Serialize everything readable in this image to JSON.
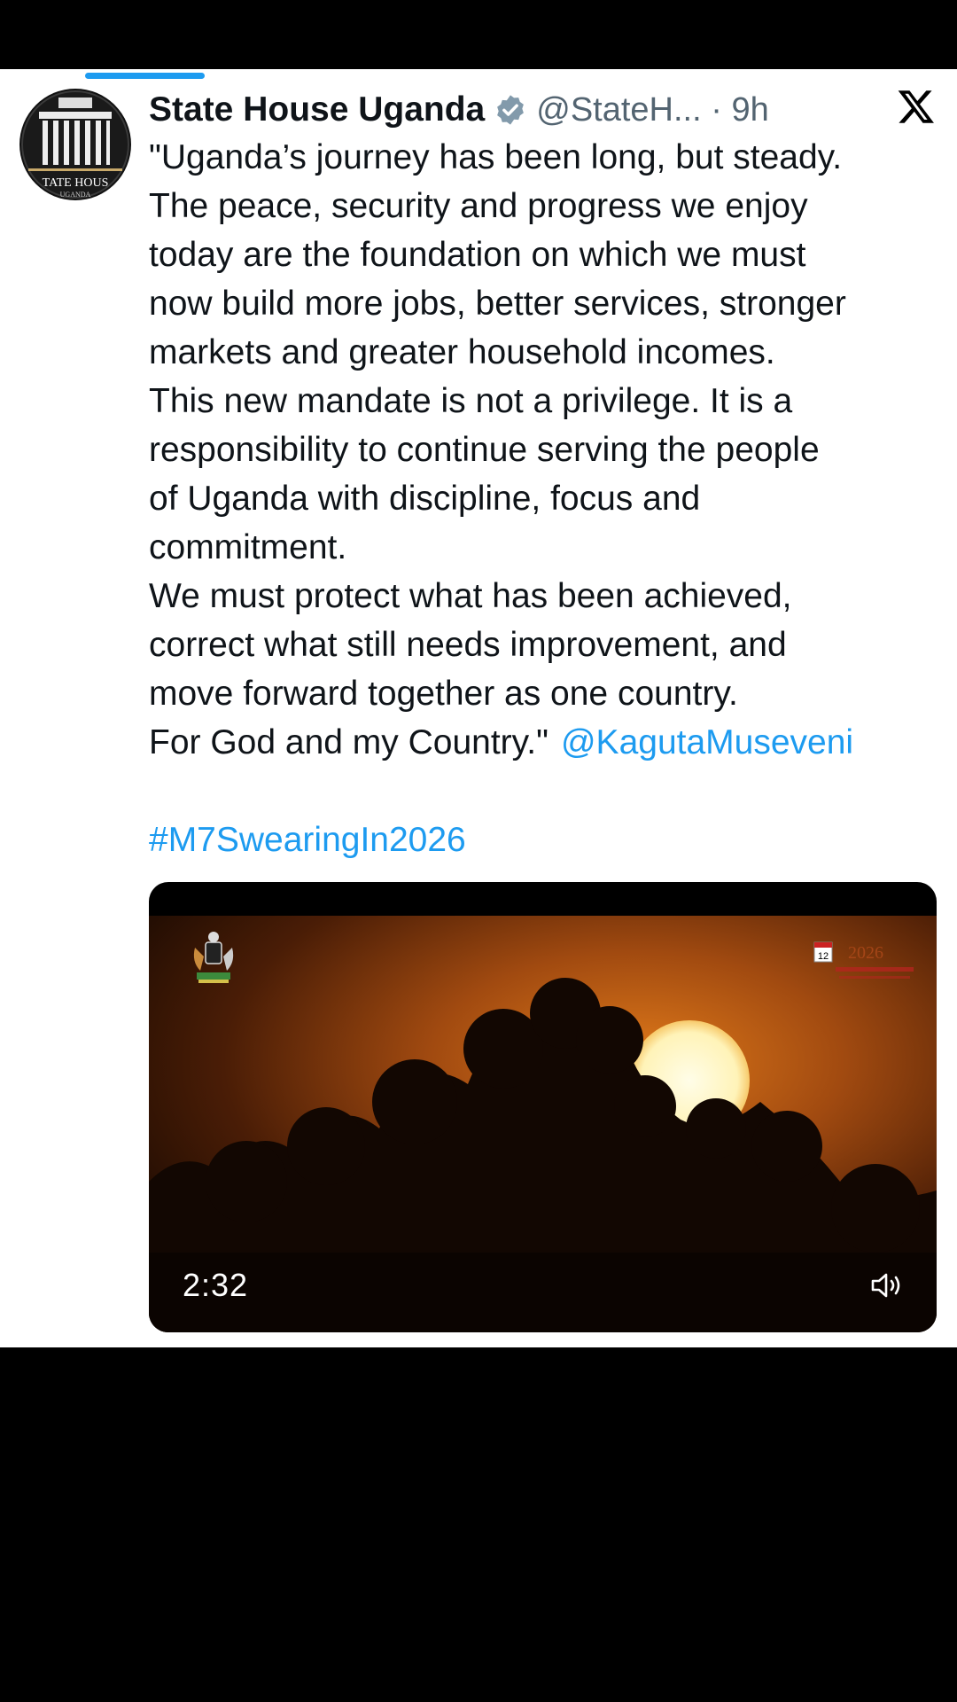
{
  "tweet": {
    "author_name": "State House Uganda",
    "handle_and_time": "@StateH... · 9h",
    "avatar_text": "TATE HOUS",
    "avatar_subtext": "UGANDA",
    "lines": [
      "\"Uganda’s journey has been long, but steady.",
      "The peace, security and progress we enjoy",
      "today are the foundation on which we must",
      "now build more jobs, better services, stronger",
      "markets and greater household incomes.",
      "This new mandate is not a privilege. It is a",
      "responsibility to continue serving the people",
      "of Uganda with discipline, focus and",
      "commitment.",
      "We must protect what has been achieved,",
      "correct what still needs improvement, and",
      "move forward together as one country."
    ],
    "last_line": "For God and my Country.\"",
    "mention": "@KagutaMuseveni",
    "hashtag": "#M7SwearingIn2026"
  },
  "video": {
    "duration": "2:32",
    "badge_day": "12",
    "badge_year": "2026"
  },
  "colors": {
    "link": "#1d9bf0",
    "text": "#0f1419",
    "secondary": "#536471"
  },
  "icons": [
    "avatar-logo",
    "verified-badge-icon",
    "x-logo-icon",
    "volume-icon",
    "coat-of-arms-icon"
  ]
}
